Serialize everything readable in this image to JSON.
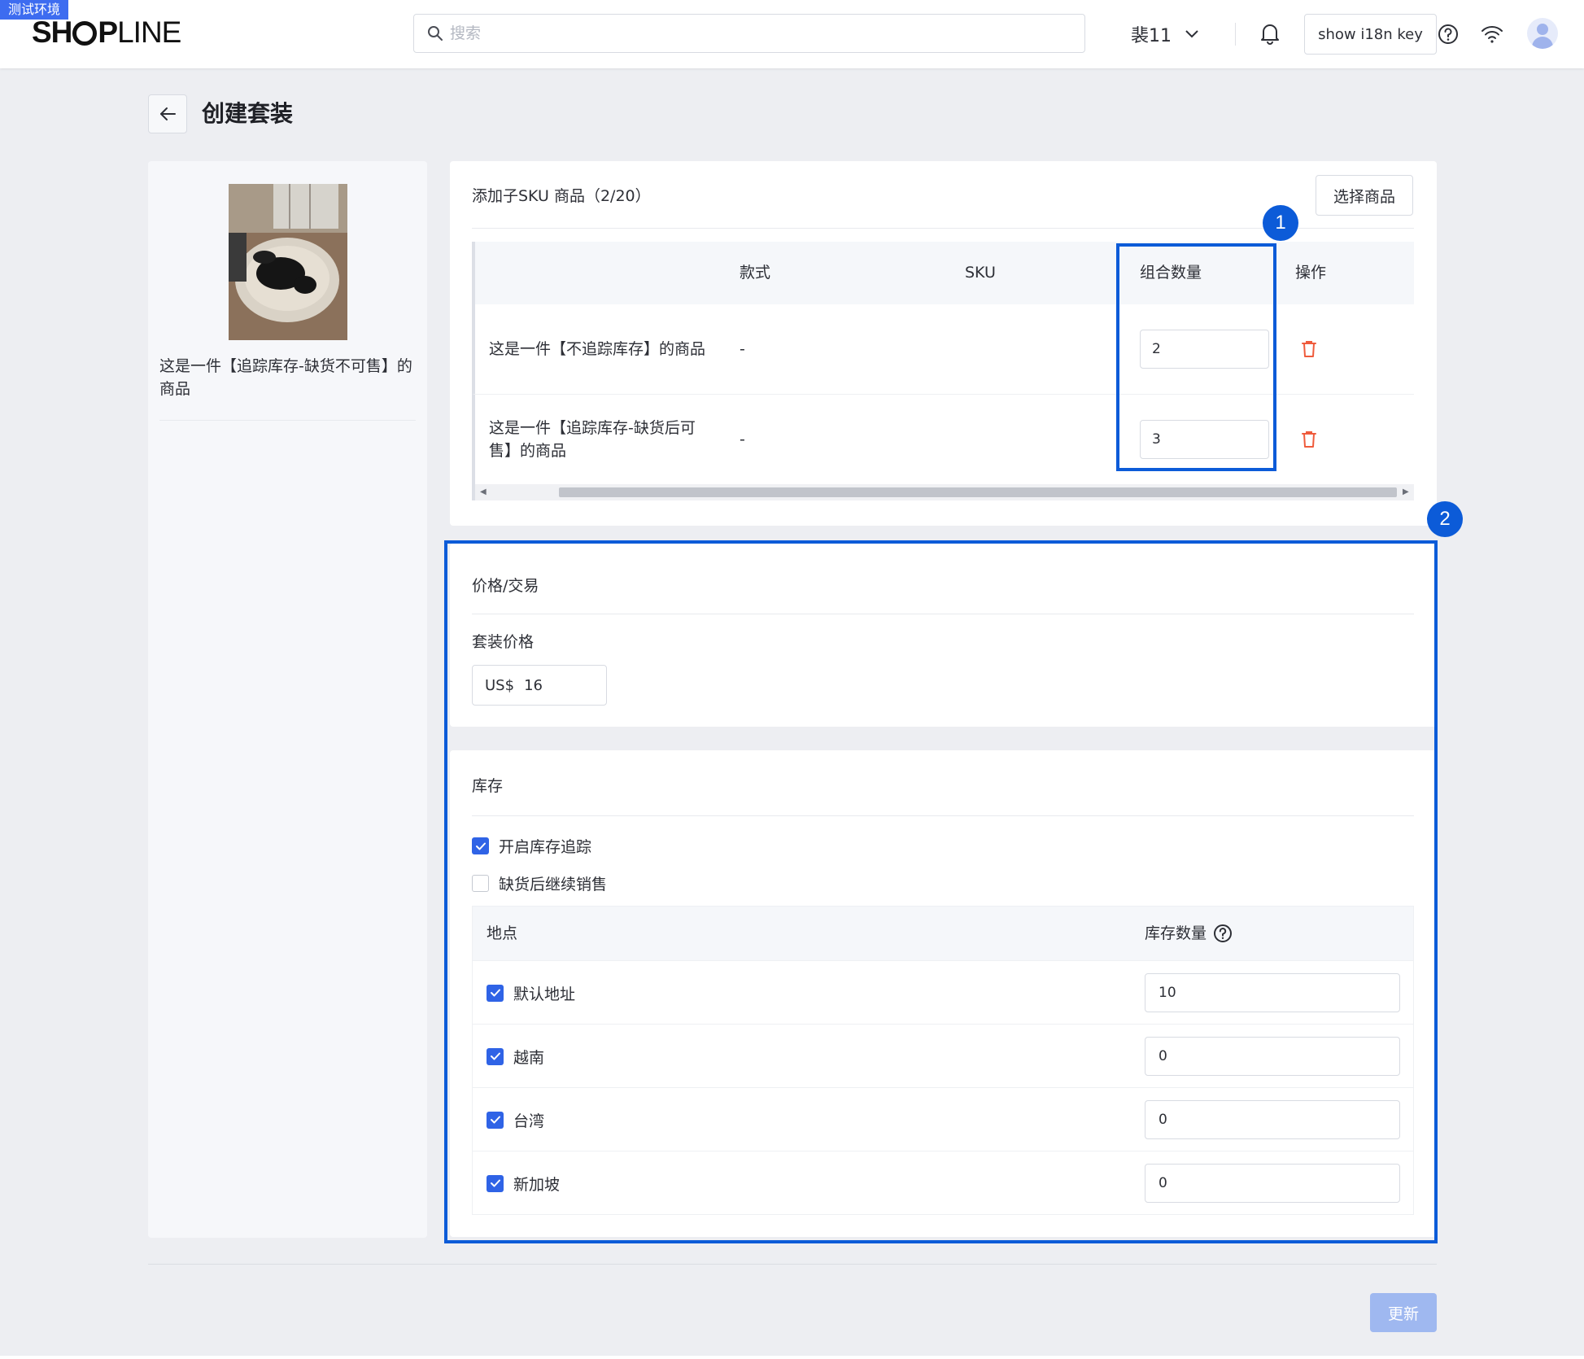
{
  "env_badge": "测试环境",
  "brand": {
    "part1": "SH",
    "part2": "P",
    "part3": "LINE"
  },
  "search": {
    "placeholder": "搜索"
  },
  "store": {
    "name": "裴11"
  },
  "header": {
    "i18n_button": "show i18n key"
  },
  "page": {
    "title": "创建套装"
  },
  "bundle_product": {
    "name": "这是一件【追踪库存-缺货不可售】的商品"
  },
  "sku_section": {
    "title": "添加子SKU 商品（2/20）",
    "select_button": "选择商品",
    "columns": {
      "variant": "款式",
      "sku": "SKU",
      "quantity": "组合数量",
      "action": "操作"
    },
    "rows": [
      {
        "name": "这是一件【不追踪库存】的商品",
        "variant": "-",
        "sku": "",
        "quantity": "2"
      },
      {
        "name": "这是一件【追踪库存-缺货后可售】的商品",
        "variant": "-",
        "sku": "",
        "quantity": "3"
      }
    ]
  },
  "annotations": {
    "marker1": "1",
    "marker2": "2"
  },
  "price_section": {
    "title": "价格/交易",
    "price_label": "套装价格",
    "currency": "US$",
    "price_value": "16"
  },
  "inventory_section": {
    "title": "库存",
    "track_inventory": {
      "label": "开启库存追踪",
      "checked": true
    },
    "continue_selling": {
      "label": "缺货后继续销售",
      "checked": false
    },
    "columns": {
      "location": "地点",
      "quantity": "库存数量"
    },
    "locations": [
      {
        "name": "默认地址",
        "checked": true,
        "quantity": "10"
      },
      {
        "name": "越南",
        "checked": true,
        "quantity": "0"
      },
      {
        "name": "台湾",
        "checked": true,
        "quantity": "0"
      },
      {
        "name": "新加坡",
        "checked": true,
        "quantity": "0"
      }
    ]
  },
  "footer": {
    "update_button": "更新"
  },
  "colors": {
    "primary": "#2f63e6",
    "annotation": "#0c5bd8",
    "danger": "#ef5b3c",
    "disabled_button": "#9fb8f0"
  }
}
